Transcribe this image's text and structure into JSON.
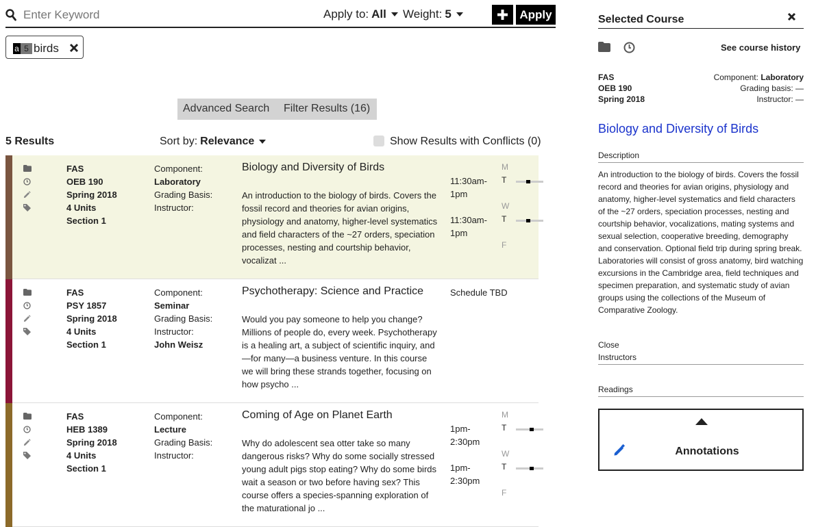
{
  "search": {
    "placeholder": "Enter Keyword"
  },
  "toolbar": {
    "apply_to_label": "Apply to:",
    "apply_to_value": "All",
    "weight_label": "Weight:",
    "weight_value": "5",
    "add_icon": "plus-icon",
    "apply_label": "Apply"
  },
  "chip": {
    "apply_code": "a",
    "weight": "5",
    "keyword": "birds",
    "remove_icon": "close-icon"
  },
  "tabs": {
    "advanced": "Advanced Search",
    "filter": "Filter Results (16)"
  },
  "results": {
    "count": "5 Results",
    "sort_label": "Sort by:",
    "sort_value": "Relevance",
    "conflicts_label": "Show Results with Conflicts (0)"
  },
  "courses": [
    {
      "color": "#7a5540",
      "highlight": "#f4f5e1",
      "school": "FAS",
      "code": "OEB 190",
      "term": "Spring 2018",
      "units": "4 Units",
      "section": "Section 1",
      "component_label": "Component:",
      "component": "Laboratory",
      "grading_label": "Grading Basis:",
      "instructor_label": "Instructor:",
      "instructor": "",
      "title": "Biology and Diversity of Birds",
      "description": "An introduction to the biology of birds. Covers the fossil record and theories for avian origins, physiology and anatomy, higher-level systematics and field characters of the ~27 orders, speciation processes, nesting and courtship behavior, vocalizat ...",
      "times": [
        "11:30am-",
        "1pm",
        "",
        "11:30am-",
        "1pm"
      ],
      "days": [
        "M",
        "T",
        "W",
        "T",
        "F"
      ]
    },
    {
      "color": "#8b1538",
      "highlight": "#ffffff",
      "school": "FAS",
      "code": "PSY 1857",
      "term": "Spring 2018",
      "units": "4 Units",
      "section": "Section 1",
      "component_label": "Component:",
      "component": "Seminar",
      "grading_label": "Grading Basis:",
      "instructor_label": "Instructor:",
      "instructor": "John Weisz",
      "title": "Psychotherapy: Science and Practice",
      "description": "Would you pay someone to help you change? Millions of people do, every week. Psychotherapy is a healing art, a subject of scientific inquiry, and—for many—a business venture. In this course we will bring these strands together, focusing on how psycho ...",
      "schedule": "Schedule TBD"
    },
    {
      "color": "#8c6a2a",
      "highlight": "#ffffff",
      "school": "FAS",
      "code": "HEB 1389",
      "term": "Spring 2018",
      "units": "4 Units",
      "section": "Section 1",
      "component_label": "Component:",
      "component": "Lecture",
      "grading_label": "Grading Basis:",
      "instructor_label": "Instructor:",
      "instructor": "",
      "title": "Coming of Age on Planet Earth",
      "description": "Why do adolescent sea otter take so many dangerous risks?  Why do some socially stressed young adult pigs stop eating? Why do some birds wait a season or two before having sex?  This course offers a species-spanning exploration of the maturational jo ...",
      "times": [
        "1pm-",
        "2:30pm",
        "",
        "1pm-",
        "2:30pm"
      ],
      "days": [
        "M",
        "T",
        "W",
        "T",
        "F"
      ]
    }
  ],
  "panel": {
    "title": "Selected Course",
    "history_link": "See course history",
    "school": "FAS",
    "code": "OEB 190",
    "term": "Spring 2018",
    "component_label": "Component:",
    "component": "Laboratory",
    "grading": "Grading basis: —",
    "instructor": "Instructor: —",
    "course_title": "Biology and Diversity of Birds",
    "description_heading": "Description",
    "description": "An introduction to the biology of birds. Covers the fossil record and theories for avian origins, physiology and anatomy, higher-level systematics and field characters of the ~27 orders, speciation processes, nesting and courtship behavior, vocalizations, mating systems and sexual selection, cooperative breeding, demography and conservation. Optional field trip during spring break. Laboratories will consist of gross anatomy, bird watching excursions in the Cambridge area, field techniques and specimen preparation, and systematic study of avian groups using the collections of the Museum of Comparative Zoology.",
    "close_label": "Close",
    "instructors_heading": "Instructors",
    "readings_heading": "Readings",
    "annotations_label": "Annotations"
  }
}
